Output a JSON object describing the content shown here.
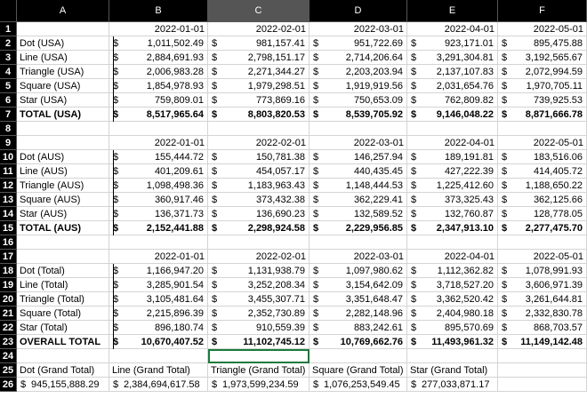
{
  "sheet": {
    "columns": [
      "A",
      "B",
      "C",
      "D",
      "E",
      "F"
    ],
    "selected_column": "C",
    "selected_cell": "C24",
    "rows": {
      "r1": {
        "B": "2022-01-01",
        "C": "2022-02-01",
        "D": "2022-03-01",
        "E": "2022-04-01",
        "F": "2022-05-01"
      },
      "r2": {
        "A": "Dot (USA)",
        "B": "1,011,502.49",
        "C": "981,157.41",
        "D": "951,722.69",
        "E": "923,171.01",
        "F": "895,475.88"
      },
      "r3": {
        "A": "Line (USA)",
        "B": "2,884,691.93",
        "C": "2,798,151.17",
        "D": "2,714,206.64",
        "E": "3,291,304.81",
        "F": "3,192,565.67"
      },
      "r4": {
        "A": "Triangle (USA)",
        "B": "2,006,983.28",
        "C": "2,271,344.27",
        "D": "2,203,203.94",
        "E": "2,137,107.83",
        "F": "2,072,994.59"
      },
      "r5": {
        "A": "Square (USA)",
        "B": "1,854,978.93",
        "C": "1,979,298.51",
        "D": "1,919,919.56",
        "E": "2,031,654.76",
        "F": "1,970,705.11"
      },
      "r6": {
        "A": "Star (USA)",
        "B": "759,809.01",
        "C": "773,869.16",
        "D": "750,653.09",
        "E": "762,809.82",
        "F": "739,925.53"
      },
      "r7": {
        "A": "TOTAL (USA)",
        "B": "8,517,965.64",
        "C": "8,803,820.53",
        "D": "8,539,705.92",
        "E": "9,146,048.22",
        "F": "8,871,666.78"
      },
      "r9": {
        "B": "2022-01-01",
        "C": "2022-02-01",
        "D": "2022-03-01",
        "E": "2022-04-01",
        "F": "2022-05-01"
      },
      "r10": {
        "A": "Dot (AUS)",
        "B": "155,444.72",
        "C": "150,781.38",
        "D": "146,257.94",
        "E": "189,191.81",
        "F": "183,516.06"
      },
      "r11": {
        "A": "Line (AUS)",
        "B": "401,209.61",
        "C": "454,057.17",
        "D": "440,435.45",
        "E": "427,222.39",
        "F": "414,405.72"
      },
      "r12": {
        "A": "Triangle (AUS)",
        "B": "1,098,498.36",
        "C": "1,183,963.43",
        "D": "1,148,444.53",
        "E": "1,225,412.60",
        "F": "1,188,650.22"
      },
      "r13": {
        "A": "Square (AUS)",
        "B": "360,917.46",
        "C": "373,432.38",
        "D": "362,229.41",
        "E": "373,325.43",
        "F": "362,125.66"
      },
      "r14": {
        "A": "Star (AUS)",
        "B": "136,371.73",
        "C": "136,690.23",
        "D": "132,589.52",
        "E": "132,760.87",
        "F": "128,778.05"
      },
      "r15": {
        "A": "TOTAL (AUS)",
        "B": "2,152,441.88",
        "C": "2,298,924.58",
        "D": "2,229,956.85",
        "E": "2,347,913.10",
        "F": "2,277,475.70"
      },
      "r17": {
        "B": "2022-01-01",
        "C": "2022-02-01",
        "D": "2022-03-01",
        "E": "2022-04-01",
        "F": "2022-05-01"
      },
      "r18": {
        "A": "Dot (Total)",
        "B": "1,166,947.20",
        "C": "1,131,938.79",
        "D": "1,097,980.62",
        "E": "1,112,362.82",
        "F": "1,078,991.93"
      },
      "r19": {
        "A": "Line (Total)",
        "B": "3,285,901.54",
        "C": "3,252,208.34",
        "D": "3,154,642.09",
        "E": "3,718,527.20",
        "F": "3,606,971.39"
      },
      "r20": {
        "A": "Triangle (Total)",
        "B": "3,105,481.64",
        "C": "3,455,307.71",
        "D": "3,351,648.47",
        "E": "3,362,520.42",
        "F": "3,261,644.81"
      },
      "r21": {
        "A": "Square (Total)",
        "B": "2,215,896.39",
        "C": "2,352,730.89",
        "D": "2,282,148.96",
        "E": "2,404,980.18",
        "F": "2,332,830.78"
      },
      "r22": {
        "A": "Star (Total)",
        "B": "896,180.74",
        "C": "910,559.39",
        "D": "883,242.61",
        "E": "895,570.69",
        "F": "868,703.57"
      },
      "r23": {
        "A": "OVERALL TOTAL",
        "B": "10,670,407.52",
        "C": "11,102,745.12",
        "D": "10,769,662.76",
        "E": "11,493,961.32",
        "F": "11,149,142.48"
      },
      "r25": {
        "A": "Dot (Grand Total)",
        "B": "Line (Grand Total)",
        "C": "Triangle (Grand Total)",
        "D": "Square (Grand Total)",
        "E": "Star (Grand Total)"
      },
      "r26": {
        "A": "945,155,888.29",
        "B": "2,384,694,617.58",
        "C": "1,973,599,234.59",
        "D": "1,076,253,549.45",
        "E": "277,033,871.17"
      }
    },
    "currency_symbol": "$",
    "row_numbers": [
      "1",
      "2",
      "3",
      "4",
      "5",
      "6",
      "7",
      "8",
      "9",
      "10",
      "11",
      "12",
      "13",
      "14",
      "15",
      "16",
      "17",
      "18",
      "19",
      "20",
      "21",
      "22",
      "23",
      "24",
      "25",
      "26"
    ],
    "bold_rows": [
      "7",
      "15",
      "23"
    ],
    "colors": {
      "header_bg": "#000000",
      "header_selected_bg": "#555555",
      "selection_border": "#1a7a3c",
      "gridline": "#d4d4d4"
    }
  }
}
